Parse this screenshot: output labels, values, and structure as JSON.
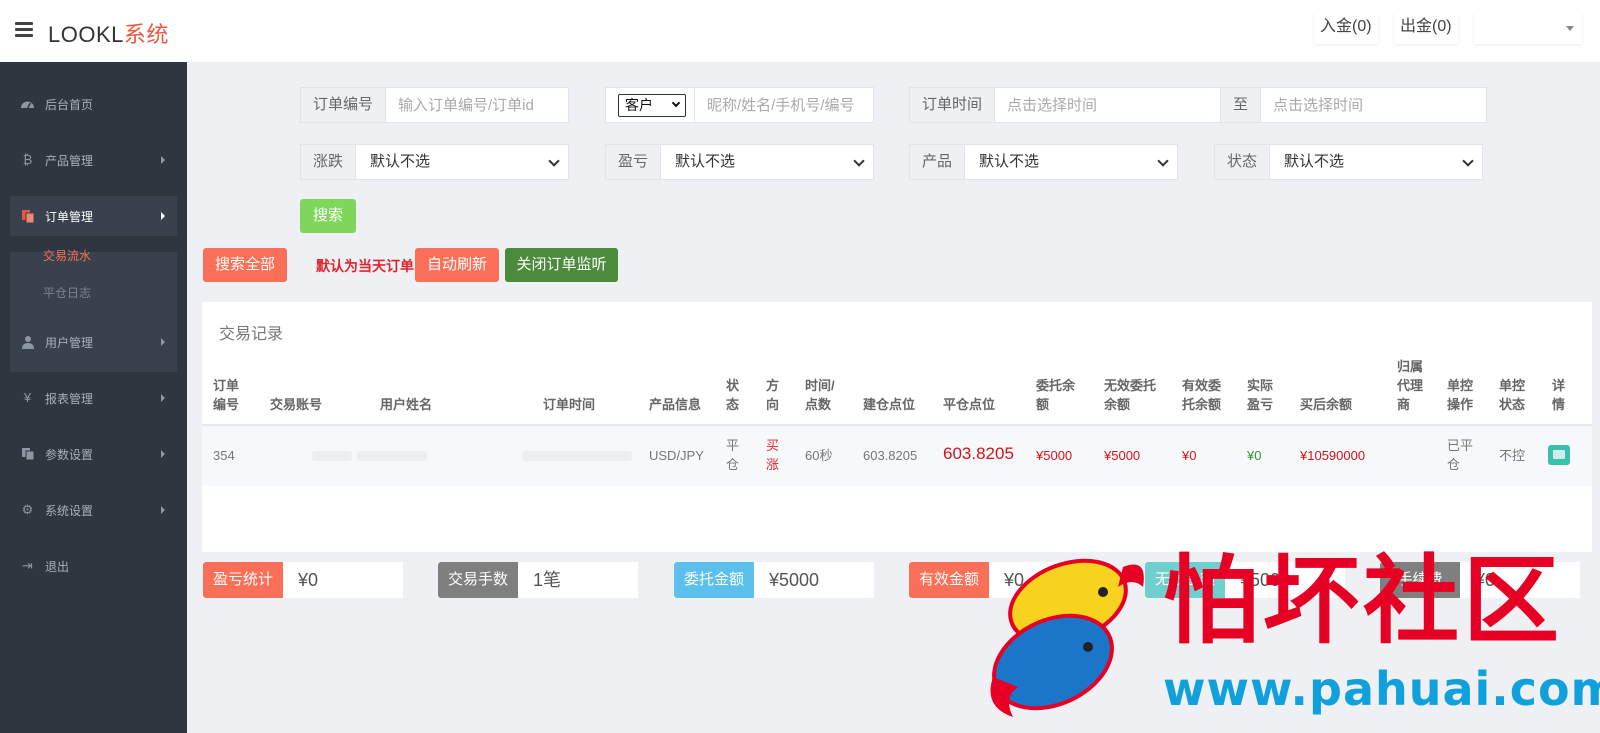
{
  "header": {
    "logo_main": "LOOKL",
    "logo_accent": "系统",
    "deposit": "入金(0)",
    "withdraw": "出金(0)"
  },
  "sidebar": {
    "items": [
      {
        "label": "后台首页",
        "icon": "dashboard-icon"
      },
      {
        "label": "产品管理",
        "icon": "bitcoin-icon"
      },
      {
        "label": "订单管理",
        "icon": "copy-icon"
      },
      {
        "label": "用户管理",
        "icon": "user-icon"
      },
      {
        "label": "报表管理",
        "icon": "yen-icon"
      },
      {
        "label": "参数设置",
        "icon": "clone-icon"
      },
      {
        "label": "系统设置",
        "icon": "gears-icon"
      },
      {
        "label": "退出",
        "icon": "sign-out-icon"
      }
    ],
    "subitems": [
      "交易流水",
      "平仓日志"
    ]
  },
  "filters": {
    "order_no_label": "订单编号",
    "order_no_placeholder": "输入订单编号/订单id",
    "customer_select": "客户",
    "customer_placeholder": "昵称/姓名/手机号/编号",
    "order_time_label": "订单时间",
    "time_start_placeholder": "点击选择时间",
    "to_label": "至",
    "time_end_placeholder": "点击选择时间",
    "updown_label": "涨跌",
    "updown_value": "默认不选",
    "profit_label": "盈亏",
    "profit_value": "默认不选",
    "product_label": "产品",
    "product_value": "默认不选",
    "status_label": "状态",
    "status_value": "默认不选",
    "search_button": "搜索"
  },
  "actions": {
    "search_all": "搜索全部",
    "default_note": "默认为当天订单",
    "auto_refresh": "自动刷新",
    "close_monitor": "关闭订单监听"
  },
  "table": {
    "title": "交易记录",
    "headers": [
      "订单编号",
      "交易账号",
      "用户姓名",
      "订单时间",
      "产品信息",
      "状态",
      "方向",
      "时间/点数",
      "建仓点位",
      "平仓点位",
      "委托余额",
      "无效委托余额",
      "有效委托余额",
      "实际盈亏",
      "买后余额",
      "归属代理商",
      "单控操作",
      "单控状态",
      "详情"
    ],
    "rows": [
      {
        "order_no": "354",
        "product": "USD/JPY",
        "status": "平仓",
        "direction": "买涨",
        "time_points": "60秒",
        "open_price": "603.8205",
        "close_price": "603.8205",
        "entrust": "¥5000",
        "invalid_entrust": "¥5000",
        "valid_entrust": "¥0",
        "profit": "¥0",
        "balance_after": "¥10590000",
        "ctrl_op": "已平仓",
        "ctrl_status": "不控"
      }
    ]
  },
  "stats": [
    {
      "label": "盈亏统计",
      "value": "¥0",
      "color": "#fa6f57"
    },
    {
      "label": "交易手数",
      "value": "1笔",
      "color": "#7f7f7f"
    },
    {
      "label": "委托金额",
      "value": "¥5000",
      "color": "#5bc0eb"
    },
    {
      "label": "有效金额",
      "value": "¥0",
      "color": "#fa6f57"
    },
    {
      "label": "无效金额",
      "value": "¥5000",
      "color": "#6fcfcf"
    },
    {
      "label": "手续费",
      "value": "¥0",
      "color": "#7f7f7f"
    }
  ],
  "watermark": {
    "title": "怕坏社区",
    "url": "www.pahuai.com"
  }
}
